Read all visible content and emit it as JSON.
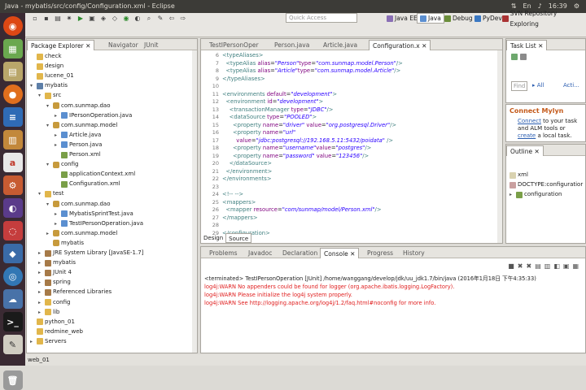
{
  "window_title": "Java - mybatis/src/config/Configuration.xml - Eclipse",
  "clock": "16:39",
  "quick_access": "Quick Access",
  "perspectives": [
    "Java EE",
    "Java",
    "Debug",
    "PyDev",
    "SVN Repository Exploring"
  ],
  "explorer": {
    "tabs": [
      "Package Explorer",
      "Navigator",
      "JUnit"
    ],
    "items": [
      {
        "label": "check",
        "icon": "folder",
        "indent": 0,
        "arrow": ""
      },
      {
        "label": "design",
        "icon": "folder",
        "indent": 0,
        "arrow": ""
      },
      {
        "label": "lucene_01",
        "icon": "folder",
        "indent": 0,
        "arrow": ""
      },
      {
        "label": "mybatis",
        "icon": "proj",
        "indent": 0,
        "arrow": "▾"
      },
      {
        "label": "src",
        "icon": "folder",
        "indent": 1,
        "arrow": "▾"
      },
      {
        "label": "com.sunmap.dao",
        "icon": "pkg",
        "indent": 2,
        "arrow": "▾"
      },
      {
        "label": "IPersonOperation.java",
        "icon": "java",
        "indent": 3,
        "arrow": "▸"
      },
      {
        "label": "com.sunmap.model",
        "icon": "pkg",
        "indent": 2,
        "arrow": "▾"
      },
      {
        "label": "Article.java",
        "icon": "java",
        "indent": 3,
        "arrow": "▸"
      },
      {
        "label": "Person.java",
        "icon": "java",
        "indent": 3,
        "arrow": "▸"
      },
      {
        "label": "Person.xml",
        "icon": "xml",
        "indent": 3,
        "arrow": ""
      },
      {
        "label": "config",
        "icon": "pkg",
        "indent": 2,
        "arrow": "▾"
      },
      {
        "label": "applicationContext.xml",
        "icon": "xml",
        "indent": 3,
        "arrow": ""
      },
      {
        "label": "Configuration.xml",
        "icon": "xml",
        "indent": 3,
        "arrow": ""
      },
      {
        "label": "test",
        "icon": "folder",
        "indent": 1,
        "arrow": "▾"
      },
      {
        "label": "com.sunmap.dao",
        "icon": "pkg",
        "indent": 2,
        "arrow": "▾"
      },
      {
        "label": "MybatisSprintTest.java",
        "icon": "java",
        "indent": 3,
        "arrow": "▸"
      },
      {
        "label": "TestIPersonOperation.java",
        "icon": "java",
        "indent": 3,
        "arrow": "▸"
      },
      {
        "label": "com.sunmap.model",
        "icon": "pkg",
        "indent": 2,
        "arrow": "▸"
      },
      {
        "label": "mybatis",
        "icon": "pkg",
        "indent": 2,
        "arrow": ""
      },
      {
        "label": "JRE System Library [JavaSE-1.7]",
        "icon": "lib",
        "indent": 1,
        "arrow": "▸"
      },
      {
        "label": "mybatis",
        "icon": "lib",
        "indent": 1,
        "arrow": "▸"
      },
      {
        "label": "JUnit 4",
        "icon": "lib",
        "indent": 1,
        "arrow": "▸"
      },
      {
        "label": "spring",
        "icon": "lib",
        "indent": 1,
        "arrow": "▸"
      },
      {
        "label": "Referenced Libraries",
        "icon": "lib",
        "indent": 1,
        "arrow": "▸"
      },
      {
        "label": "config",
        "icon": "folder",
        "indent": 1,
        "arrow": "▸"
      },
      {
        "label": "lib",
        "icon": "folder",
        "indent": 1,
        "arrow": "▸"
      },
      {
        "label": "python_01",
        "icon": "folder",
        "indent": 0,
        "arrow": ""
      },
      {
        "label": "redmine_web",
        "icon": "folder",
        "indent": 0,
        "arrow": ""
      },
      {
        "label": "Servers",
        "icon": "folder",
        "indent": 0,
        "arrow": "▸"
      }
    ]
  },
  "editor": {
    "tabs": [
      "TestIPersonOper",
      "Person.java",
      "Article.java",
      "Configuration.x"
    ],
    "bottom_tabs": [
      "Design",
      "Source"
    ],
    "lines": [
      {
        "n": "6",
        "html": "<span class='tg'>&lt;typeAliases&gt;</span>"
      },
      {
        "n": "7",
        "html": "&nbsp;&nbsp;<span class='tg'>&lt;typeAlias </span><span class='at'>alias</span>=<span class='av'>\"Person\"</span><span class='at'>type</span>=<span class='av'>\"com.sunmap.model.Person\"</span><span class='tg'>/&gt;</span>"
      },
      {
        "n": "8",
        "html": "&nbsp;&nbsp;<span class='tg'>&lt;typeAlias </span><span class='at'>alias</span>=<span class='av'>\"Article\"</span><span class='at'>type</span>=<span class='av'>\"com.sunmap.model.Article\"</span><span class='tg'>/&gt;</span>"
      },
      {
        "n": "9",
        "html": "<span class='tg'>&lt;/typeAliases&gt;</span>"
      },
      {
        "n": "10",
        "html": ""
      },
      {
        "n": "11",
        "html": "<span class='tg'>&lt;environments </span><span class='at'>default</span>=<span class='av'>\"development\"</span><span class='tg'>&gt;</span>"
      },
      {
        "n": "12",
        "html": "&nbsp;&nbsp;<span class='tg'>&lt;environment </span><span class='at'>id</span>=<span class='av'>\"development\"</span><span class='tg'>&gt;</span>"
      },
      {
        "n": "13",
        "html": "&nbsp;&nbsp;&nbsp;&nbsp;<span class='tg'>&lt;transactionManager </span><span class='at'>type</span>=<span class='av'>\"JDBC\"</span><span class='tg'>/&gt;</span>"
      },
      {
        "n": "14",
        "html": "&nbsp;&nbsp;&nbsp;&nbsp;<span class='tg'>&lt;dataSource </span><span class='at'>type</span>=<span class='av'>\"POOLED\"</span><span class='tg'>&gt;</span>"
      },
      {
        "n": "15",
        "html": "&nbsp;&nbsp;&nbsp;&nbsp;&nbsp;&nbsp;<span class='tg'>&lt;property </span><span class='at'>name</span>=<span class='av'>\"driver\"</span> <span class='at'>value</span>=<span class='av'>\"org.postgresql.Driver\"</span><span class='tg'>/&gt;</span>"
      },
      {
        "n": "16",
        "html": "&nbsp;&nbsp;&nbsp;&nbsp;&nbsp;&nbsp;<span class='tg'>&lt;property </span><span class='at'>name</span>=<span class='av'>\"url\"</span>"
      },
      {
        "n": "17",
        "html": "&nbsp;&nbsp;&nbsp;&nbsp;&nbsp;&nbsp;&nbsp;&nbsp;<span class='at'>value</span>=<span class='av'>\"jdbc:postgresql://192.168.5.11:5432/poidata\"</span> <span class='tg'>/&gt;</span>"
      },
      {
        "n": "18",
        "html": "&nbsp;&nbsp;&nbsp;&nbsp;&nbsp;&nbsp;<span class='tg'>&lt;property </span><span class='at'>name</span>=<span class='av'>\"username\"</span><span class='at'>value</span>=<span class='av'>\"postgres\"</span><span class='tg'>/&gt;</span>"
      },
      {
        "n": "19",
        "html": "&nbsp;&nbsp;&nbsp;&nbsp;&nbsp;&nbsp;<span class='tg'>&lt;property </span><span class='at'>name</span>=<span class='av'>\"password\"</span> <span class='at'>value</span>=<span class='av'>\"123456\"</span><span class='tg'>/&gt;</span>"
      },
      {
        "n": "20",
        "html": "&nbsp;&nbsp;&nbsp;&nbsp;<span class='tg'>&lt;/dataSource&gt;</span>"
      },
      {
        "n": "21",
        "html": "&nbsp;&nbsp;<span class='tg'>&lt;/environment&gt;</span>"
      },
      {
        "n": "22",
        "html": "<span class='tg'>&lt;/environments&gt;</span>"
      },
      {
        "n": "23",
        "html": ""
      },
      {
        "n": "24",
        "html": "<span class='tg'>&lt;!-- --&gt;</span>"
      },
      {
        "n": "25",
        "html": "<span class='tg'>&lt;mappers&gt;</span>"
      },
      {
        "n": "26",
        "html": "&nbsp;&nbsp;<span class='tg'>&lt;mapper </span><span class='at'>resource</span>=<span class='av'>\"com/sunmap/model/Person.xml\"</span><span class='tg'>/&gt;</span>"
      },
      {
        "n": "27",
        "html": "<span class='tg'>&lt;/mappers&gt;</span>"
      },
      {
        "n": "28",
        "html": ""
      },
      {
        "n": "29",
        "html": "<span class='tg'>&lt;/configuration&gt;</span>"
      }
    ]
  },
  "tasklist": {
    "title": "Task List",
    "find_placeholder": "Find",
    "all": "All",
    "acti": "Acti..."
  },
  "mylyn": {
    "title": "Connect Mylyn",
    "text1": "Connect",
    "text2": " to your task and ALM tools or ",
    "text3": "create",
    "text4": " a local task."
  },
  "outline": {
    "title": "Outline",
    "items": [
      {
        "label": "xml",
        "indent": 0
      },
      {
        "label": "DOCTYPE:configuratior",
        "indent": 0
      },
      {
        "label": "configuration",
        "indent": 0
      }
    ]
  },
  "console": {
    "tabs": [
      "Problems",
      "Javadoc",
      "Declaration",
      "Console",
      "Progress",
      "History"
    ],
    "header": "<terminated> TestIPersonOperation [JUnit] /home/wanggang/develop/jdk/uu_jdk1.7/bin/java (2016年1月18日 下午4:35:33)",
    "lines": [
      "log4j:WARN No appenders could be found for logger (org.apache.ibatis.logging.LogFactory).",
      "log4j:WARN Please initialize the log4j system properly.",
      "log4j:WARN See http://logging.apache.org/log4j/1.2/faq.html#noconfig for more info."
    ]
  },
  "statusbar": "web_01"
}
